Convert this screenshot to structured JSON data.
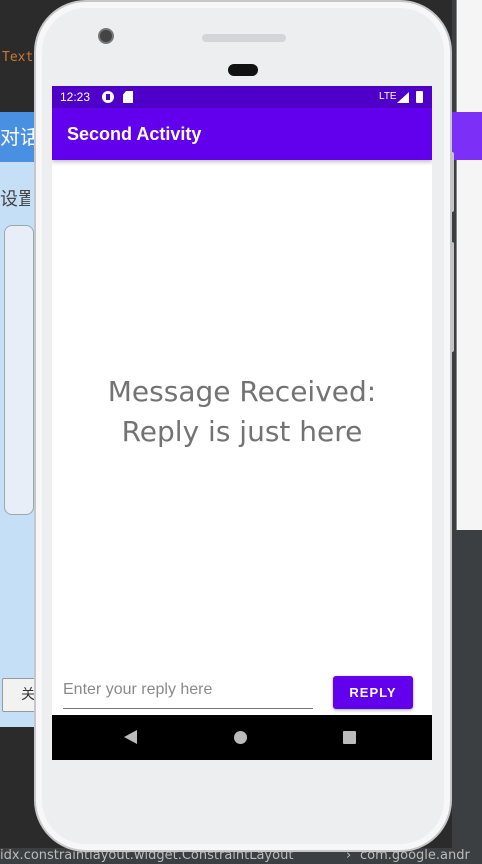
{
  "ide": {
    "code_text": "Text",
    "left_panel_title": "对话",
    "left_panel_sub": "设置",
    "left_button_label": "关",
    "statusbar_left": "idx.constraintlayout.widget.ConstraintLayout",
    "statusbar_sep": "›",
    "statusbar_right": "com.google.andr"
  },
  "device": {
    "status_bar": {
      "time": "12:23",
      "network": "LTE"
    },
    "app_bar": {
      "title": "Second Activity"
    },
    "content": {
      "message_line1": "Message Received:",
      "message_line2": "Reply is just here"
    },
    "reply": {
      "placeholder": "Enter your reply here",
      "value": "",
      "button_label": "REPLY"
    },
    "colors": {
      "primary": "#6200ee",
      "primary_dark": "#4f00c8",
      "message_text": "#737373"
    }
  }
}
